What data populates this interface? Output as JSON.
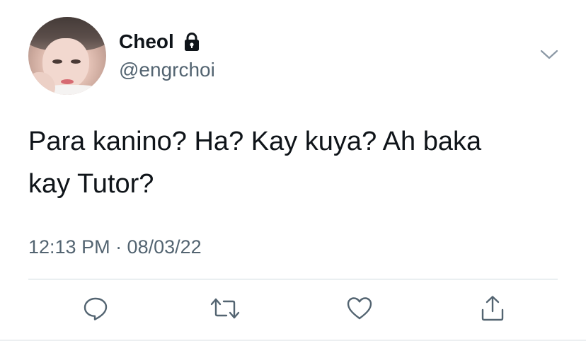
{
  "tweet": {
    "author": {
      "display_name": "Cheol",
      "handle": "@engrchoi",
      "protected_icon": "lock-icon",
      "avatar": "profile-photo"
    },
    "text_line_1": "Para kanino? Ha? Kay kuya? Ah baka",
    "text_line_2": "kay Tutor?",
    "timestamp": "12:13 PM · 08/03/22",
    "menu_icon": "chevron-down-icon",
    "actions": [
      {
        "name": "reply",
        "icon": "speech-bubble-icon"
      },
      {
        "name": "retweet",
        "icon": "retweet-icon"
      },
      {
        "name": "like",
        "icon": "heart-icon"
      },
      {
        "name": "share",
        "icon": "share-icon"
      }
    ]
  },
  "colors": {
    "text_primary": "#0f1419",
    "text_secondary": "#536471",
    "divider": "#cfd9de",
    "icon": "#536471"
  }
}
